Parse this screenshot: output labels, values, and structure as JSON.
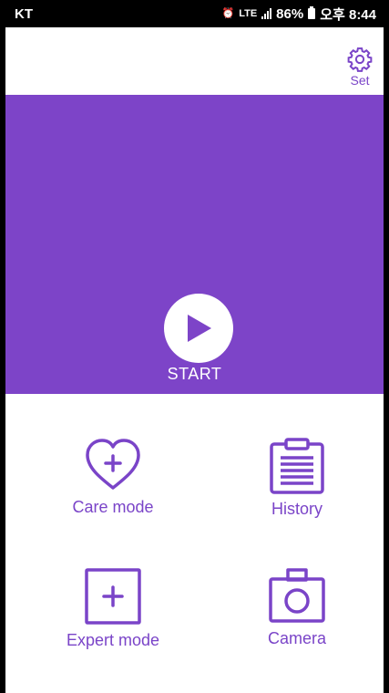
{
  "status_bar": {
    "carrier": "KT",
    "network": "LTE",
    "battery": "86%",
    "time": "오후 8:44"
  },
  "header": {
    "settings_label": "Set",
    "settings_icon": "gear-icon"
  },
  "hero": {
    "start_label": "START",
    "play_icon": "play-icon"
  },
  "menu": {
    "care_mode": {
      "label": "Care mode",
      "icon": "heart-plus-icon"
    },
    "history": {
      "label": "History",
      "icon": "clipboard-icon"
    },
    "expert_mode": {
      "label": "Expert mode",
      "icon": "square-plus-icon"
    },
    "camera": {
      "label": "Camera",
      "icon": "camera-icon"
    }
  },
  "colors": {
    "accent": "#7d44c8",
    "background": "#ffffff"
  }
}
